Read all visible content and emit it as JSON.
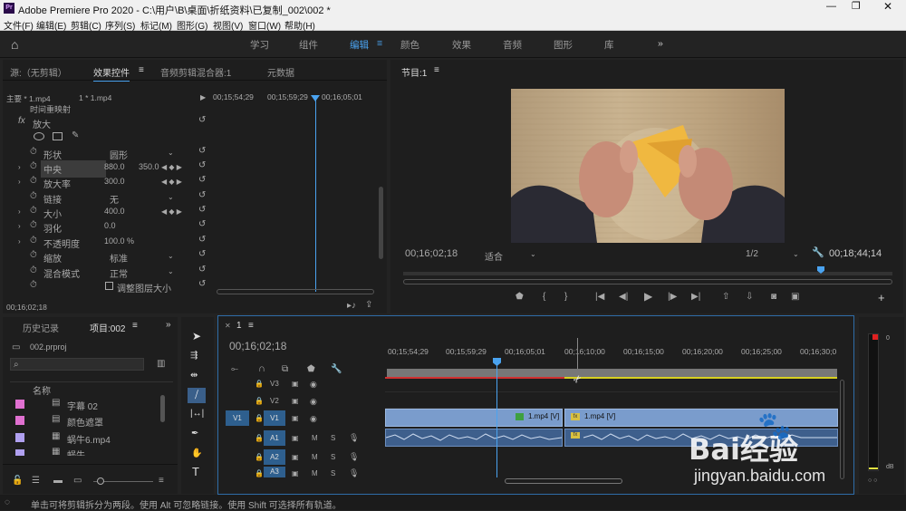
{
  "window": {
    "title": "Adobe Premiere Pro 2020 - C:\\用户\\B\\桌面\\折纸资料\\已复制_002\\002 *",
    "app_icon": "Pr"
  },
  "menu": [
    "文件(F)",
    "编辑(E)",
    "剪辑(C)",
    "序列(S)",
    "标记(M)",
    "图形(G)",
    "视图(V)",
    "窗口(W)",
    "帮助(H)"
  ],
  "workspaces": {
    "items": [
      "学习",
      "组件",
      "编辑",
      "颜色",
      "效果",
      "音频",
      "图形",
      "库"
    ],
    "active": "编辑",
    "more": "»"
  },
  "effect_panel": {
    "tabs": [
      "源:（无剪辑）",
      "效果控件",
      "音频剪辑混合器:1",
      "元数据"
    ],
    "active_tab": "效果控件",
    "breadcrumb_master": "主要 * 1.mp4",
    "breadcrumb_clip": "1 * 1.mp4",
    "time_ruler": [
      "00;15;54;29",
      "00;15;59;29",
      "00;16;05;01"
    ],
    "section_time_remap": "时间重映射",
    "fx_name": "放大",
    "props": [
      {
        "label": "形状",
        "value": "圆形"
      },
      {
        "label": "中央",
        "value": "880.0",
        "value2": "350.0"
      },
      {
        "label": "放大率",
        "value": "300.0"
      },
      {
        "label": "链接",
        "value": "无"
      },
      {
        "label": "大小",
        "value": "400.0"
      },
      {
        "label": "羽化",
        "value": "0.0"
      },
      {
        "label": "不透明度",
        "value": "100.0 %"
      },
      {
        "label": "缩放",
        "value": "标准"
      },
      {
        "label": "混合模式",
        "value": "正常"
      },
      {
        "label": "",
        "value": "调整图层大小"
      }
    ],
    "timecode": "00;16;02;18"
  },
  "program_monitor": {
    "title": "节目:1",
    "timecode": "00;16;02;18",
    "fit": "适合",
    "resolution": "1/2",
    "duration": "00;18;44;14"
  },
  "project_panel": {
    "tabs": [
      "历史记录",
      "项目:002"
    ],
    "active_tab": "项目:002",
    "project_file": "002.prproj",
    "column_name": "名称",
    "items": [
      {
        "name": "字幕 02",
        "color": "#e070d0"
      },
      {
        "name": "颜色遮罩",
        "color": "#e070d0"
      },
      {
        "name": "蜗牛6.mp4",
        "color": "#b0a0f0"
      },
      {
        "name": "蜗牛...",
        "color": "#b0a0f0"
      }
    ]
  },
  "timeline": {
    "sequence": "1",
    "timecode": "00;16;02;18",
    "ruler": [
      "00;15;54;29",
      "00;15;59;29",
      "00;16;05;01",
      "00;16;10;00",
      "00;16;15;00",
      "00;16;20;00",
      "00;16;25;00",
      "00;16;30;0"
    ],
    "video_tracks": [
      "V3",
      "V2",
      "V1"
    ],
    "audio_tracks": [
      "A1",
      "A2",
      "A3"
    ],
    "source_v": "V1",
    "clips": [
      {
        "label": "1.mp4 [V]"
      },
      {
        "label": "1.mp4 [V]"
      }
    ],
    "track_letters": {
      "mute": "M",
      "solo": "S"
    }
  },
  "meter": {
    "label_db": "dB",
    "zero": "0"
  },
  "status": {
    "text": "单击可将剪辑拆分为两段。使用 Alt 可忽略链接。使用 Shift 可选择所有轨道。"
  },
  "watermark": {
    "brand": "Bai经验",
    "url": "jingyan.baidu.com"
  }
}
